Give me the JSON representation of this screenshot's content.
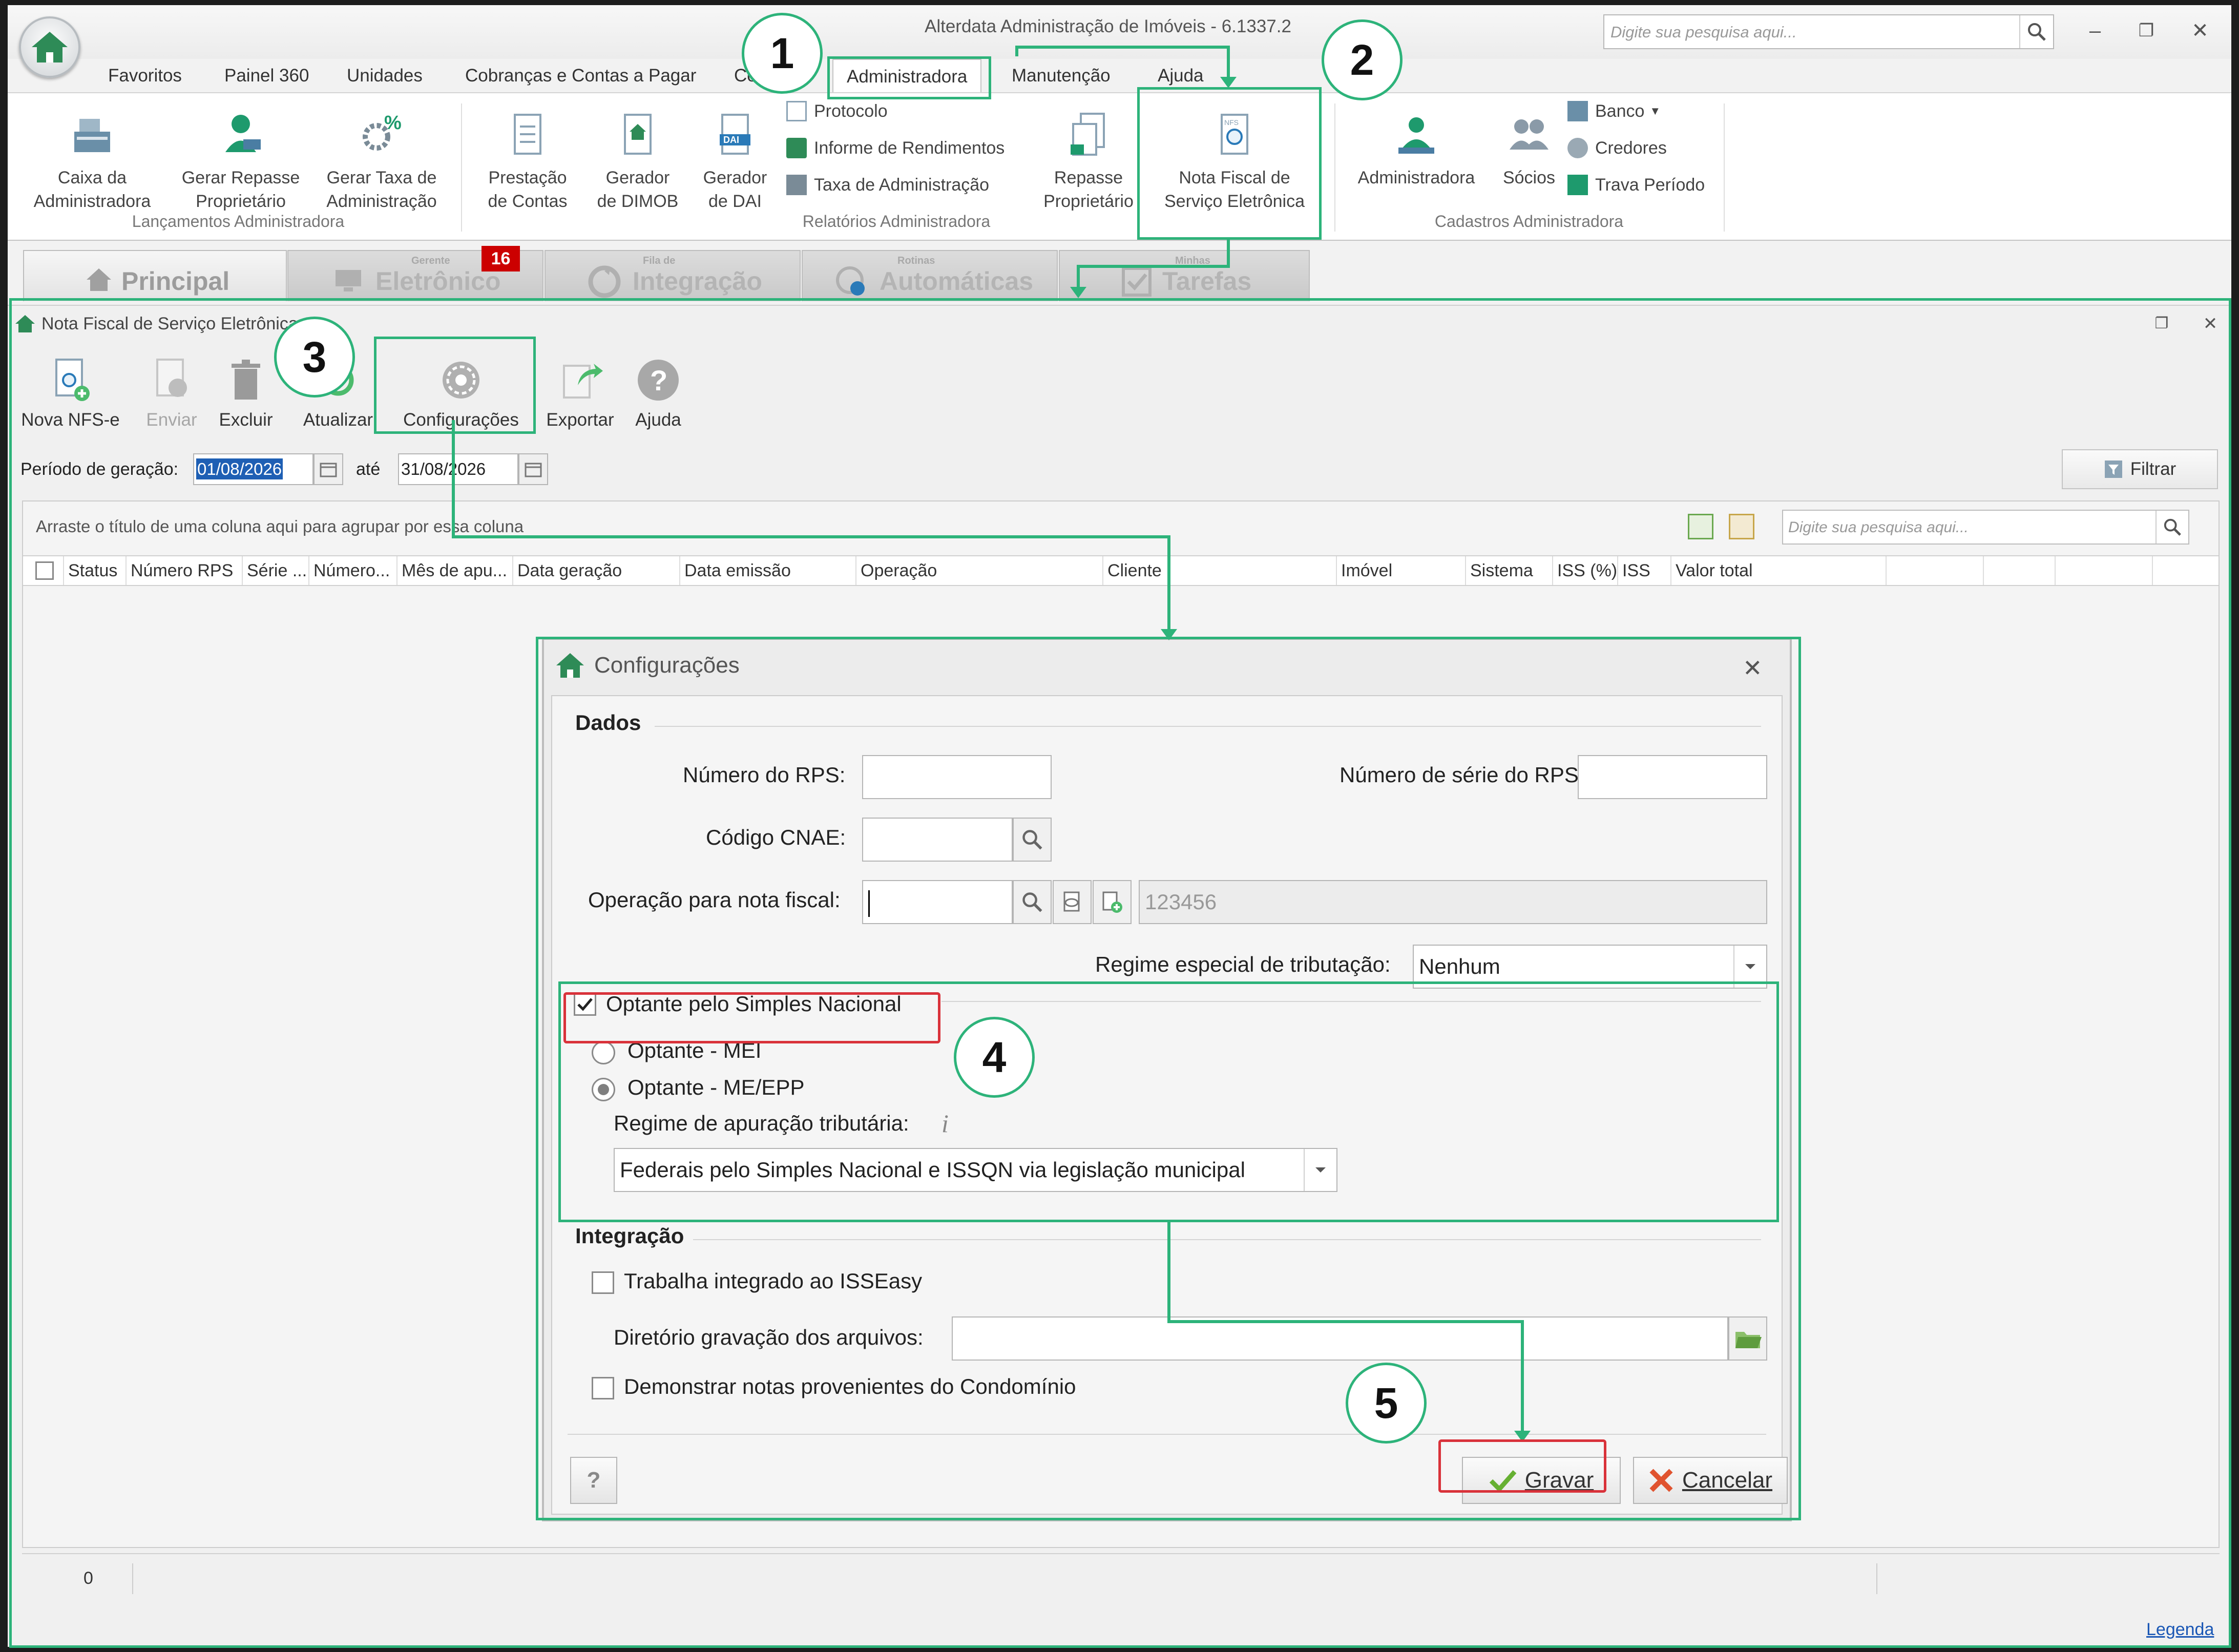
{
  "app": {
    "title": "Alterdata Administração de Imóveis - 6.1337.2",
    "search_placeholder": "Digite sua pesquisa aqui..."
  },
  "menu": [
    "Favoritos",
    "Painel 360",
    "Unidades",
    "Cobranças e Contas a Pagar",
    "Contábil",
    "Administradora",
    "Manutenção",
    "Ajuda"
  ],
  "ribbon": {
    "lancamentos": {
      "btn1": [
        "Caixa da",
        "Administradora"
      ],
      "btn2": [
        "Gerar Repasse",
        "Proprietário"
      ],
      "btn3": [
        "Gerar Taxa de",
        "Administração"
      ],
      "label": "Lançamentos Administradora"
    },
    "relatorios": {
      "btn1": [
        "Prestação",
        "de Contas"
      ],
      "btn2": [
        "Gerador",
        "de DIMOB"
      ],
      "btn3": [
        "Gerador",
        "de DAI"
      ],
      "small": [
        "Protocolo",
        "Informe de Rendimentos",
        "Taxa de Administração"
      ],
      "btn4": [
        "Repasse",
        "Proprietário"
      ],
      "btn5": [
        "Nota Fiscal de",
        "Serviço Eletrônica"
      ],
      "label": "Relatórios Administradora"
    },
    "cadastros": {
      "btn1": "Administradora",
      "btn2": "Sócios",
      "small": [
        "Banco",
        "Credores",
        "Trava Período"
      ],
      "label": "Cadastros Administradora"
    }
  },
  "tabs": {
    "principal": "Principal",
    "gerente_small": "Gerente",
    "gerente": "Eletrônico",
    "gerente_badge": "16",
    "fila_small": "Fila de",
    "fila": "Integração",
    "rotinas_small": "Rotinas",
    "rotinas": "Automáticas",
    "minhas_small": "Minhas",
    "minhas": "Tarefas"
  },
  "nfse": {
    "window_title": "Nota Fiscal de Serviço Eletrônica",
    "toolbar": [
      "Nova NFS-e",
      "Enviar",
      "Excluir",
      "Atualizar",
      "Configurações",
      "Exportar",
      "Ajuda"
    ],
    "periodo_label": "Período de geração:",
    "date_from": "01/08/2026",
    "ate_label": "até",
    "date_to": "31/08/2026",
    "filtrar": "Filtrar",
    "group_hint": "Arraste o título de uma coluna aqui para agrupar por essa coluna",
    "search_placeholder": "Digite sua pesquisa aqui...",
    "columns": [
      "Status",
      "Número RPS",
      "Série ...",
      "Número...",
      "Mês de apu...",
      "Data geração",
      "Data emissão",
      "Operação",
      "Cliente",
      "Imóvel",
      "Sistema",
      "ISS (%)",
      "ISS",
      "Valor total"
    ],
    "record_count": "0",
    "legenda": "Legenda"
  },
  "dialog": {
    "title": "Configurações",
    "dados": "Dados",
    "numero_rps": "Número do RPS:",
    "numero_serie_rps": "Número de série do RPS:",
    "codigo_cnae": "Código CNAE:",
    "operacao_label": "Operação para nota fiscal:",
    "operacao_desc": "123456",
    "regime_especial_label": "Regime especial de tributação:",
    "regime_especial_value": "Nenhum",
    "optante_simples": "Optante pelo Simples Nacional",
    "optante_mei": "Optante - MEI",
    "optante_meepp": "Optante - ME/EPP",
    "regime_apuracao_label": "Regime de apuração tributária:",
    "regime_apuracao_value": "Federais pelo Simples Nacional e ISSQN via legislação municipal",
    "integracao": "Integração",
    "isseasy": "Trabalha integrado ao ISSEasy",
    "diretorio_label": "Diretório gravação dos arquivos:",
    "demonstrar": "Demonstrar notas provenientes do Condomínio",
    "help": "?",
    "gravar": "Gravar",
    "cancelar": "Cancelar"
  },
  "steps": [
    "1",
    "2",
    "3",
    "4",
    "5"
  ],
  "colors": {
    "highlight_green": "#2db37a",
    "highlight_red": "#d9323a",
    "badge_red": "#cc0000",
    "selection_blue": "#1e5fb4"
  }
}
